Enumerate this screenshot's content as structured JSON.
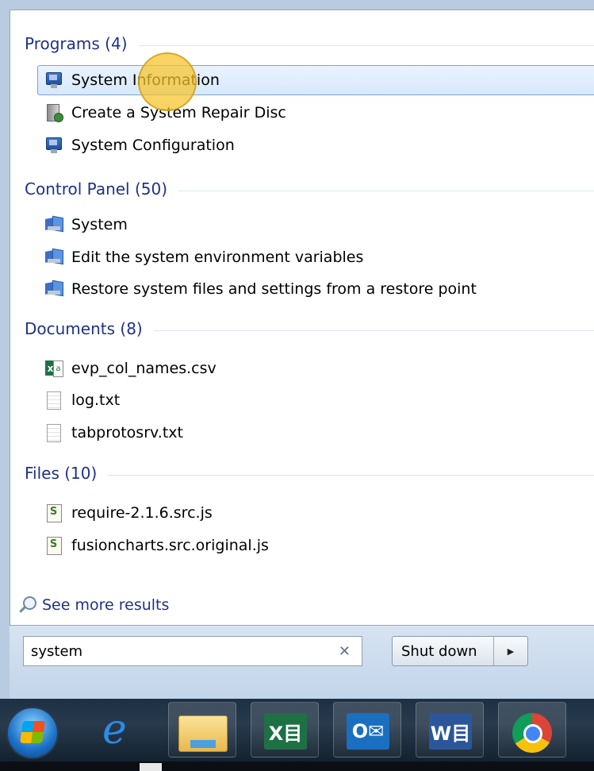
{
  "groups": [
    {
      "title": "Programs (4)",
      "items": [
        {
          "label": "System Information",
          "icon": "system-information-icon",
          "selected": true
        },
        {
          "label": "Create a System Repair Disc",
          "icon": "repair-disc-icon"
        },
        {
          "label": "System Configuration",
          "icon": "system-configuration-icon"
        }
      ]
    },
    {
      "title": "Control Panel (50)",
      "items": [
        {
          "label": "System",
          "icon": "control-panel-icon"
        },
        {
          "label": "Edit the system environment variables",
          "icon": "control-panel-icon"
        },
        {
          "label": "Restore system files and settings from a restore point",
          "icon": "control-panel-icon"
        }
      ]
    },
    {
      "title": "Documents (8)",
      "items": [
        {
          "label": "evp_col_names.csv",
          "icon": "excel-file-icon"
        },
        {
          "label": "log.txt",
          "icon": "text-file-icon"
        },
        {
          "label": "tabprotosrv.txt",
          "icon": "text-file-icon"
        }
      ]
    },
    {
      "title": "Files (10)",
      "items": [
        {
          "label": "require-2.1.6.src.js",
          "icon": "script-file-icon"
        },
        {
          "label": "fusioncharts.src.original.js",
          "icon": "script-file-icon"
        }
      ]
    }
  ],
  "see_more": "See more results",
  "search": {
    "value": "system",
    "clear_symbol": "✕"
  },
  "shutdown": {
    "label": "Shut down",
    "arrow": "▶"
  },
  "taskbar": {
    "items": [
      "start-button",
      "internet-explorer",
      "file-explorer",
      "excel",
      "outlook",
      "word",
      "chrome"
    ],
    "excel_glyph": "X目",
    "outlook_glyph": "O✉",
    "word_glyph": "W目"
  },
  "colors": {
    "group_title": "#1e3287",
    "selection": "#d7e8fb",
    "cursor_highlight": "#f6c428"
  }
}
